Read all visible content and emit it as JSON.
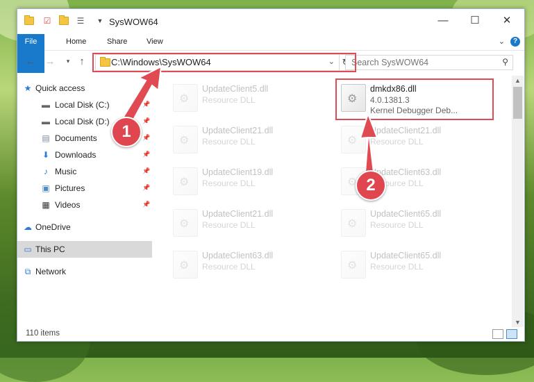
{
  "window": {
    "title": "SysWOW64",
    "controls": {
      "minimize": "—",
      "maximize": "☐",
      "close": "✕"
    }
  },
  "ribbon": {
    "tabs": [
      "File",
      "Home",
      "Share",
      "View"
    ],
    "help": "?"
  },
  "address_bar": {
    "path": "C:\\Windows\\SysWOW64",
    "search_placeholder": "Search SysWOW64"
  },
  "sidebar": {
    "items": [
      {
        "label": "Quick access",
        "icon": "star-icon",
        "pinned": false
      },
      {
        "label": "Local Disk (C:)",
        "icon": "drive-icon",
        "pinned": true
      },
      {
        "label": "Local Disk (D:)",
        "icon": "drive-icon",
        "pinned": true
      },
      {
        "label": "Documents",
        "icon": "documents-icon",
        "pinned": true
      },
      {
        "label": "Downloads",
        "icon": "download-icon",
        "pinned": true
      },
      {
        "label": "Music",
        "icon": "music-icon",
        "pinned": true
      },
      {
        "label": "Pictures",
        "icon": "pictures-icon",
        "pinned": true
      },
      {
        "label": "Videos",
        "icon": "videos-icon",
        "pinned": true
      },
      {
        "label": "OneDrive",
        "icon": "cloud-icon",
        "pinned": false
      },
      {
        "label": "This PC",
        "icon": "computer-icon",
        "pinned": false
      },
      {
        "label": "Network",
        "icon": "network-icon",
        "pinned": false
      }
    ]
  },
  "files": {
    "highlighted": {
      "name": "dmkdx86.dll",
      "version": "4.0.1381.3",
      "description": "Kernel Debugger Deb..."
    },
    "faded": [
      {
        "name": "UpdateClient5.dll",
        "type": "Resource DLL"
      },
      {
        "name": "UpdateClient21.dll",
        "type": "Resource DLL"
      },
      {
        "name": "UpdateClient21.dll",
        "type": "Resource DLL"
      },
      {
        "name": "UpdateClient19.dll",
        "type": "Resource DLL"
      },
      {
        "name": "UpdateClient63.dll",
        "type": "Resource DLL"
      },
      {
        "name": "UpdateClient21.dll",
        "type": "Resource DLL"
      },
      {
        "name": "UpdateClient65.dll",
        "type": "Resource DLL"
      },
      {
        "name": "UpdateClient63.dll",
        "type": "Resource DLL"
      },
      {
        "name": "UpdateClient65.dll",
        "type": "Resource DLL"
      }
    ]
  },
  "status_bar": {
    "item_count": "110 items"
  },
  "annotations": {
    "step1": "1",
    "step2": "2",
    "color": "#e04b53"
  },
  "colors": {
    "accent": "#1979ca",
    "highlight": "#e04b53",
    "selected": "#d9d9d9"
  }
}
